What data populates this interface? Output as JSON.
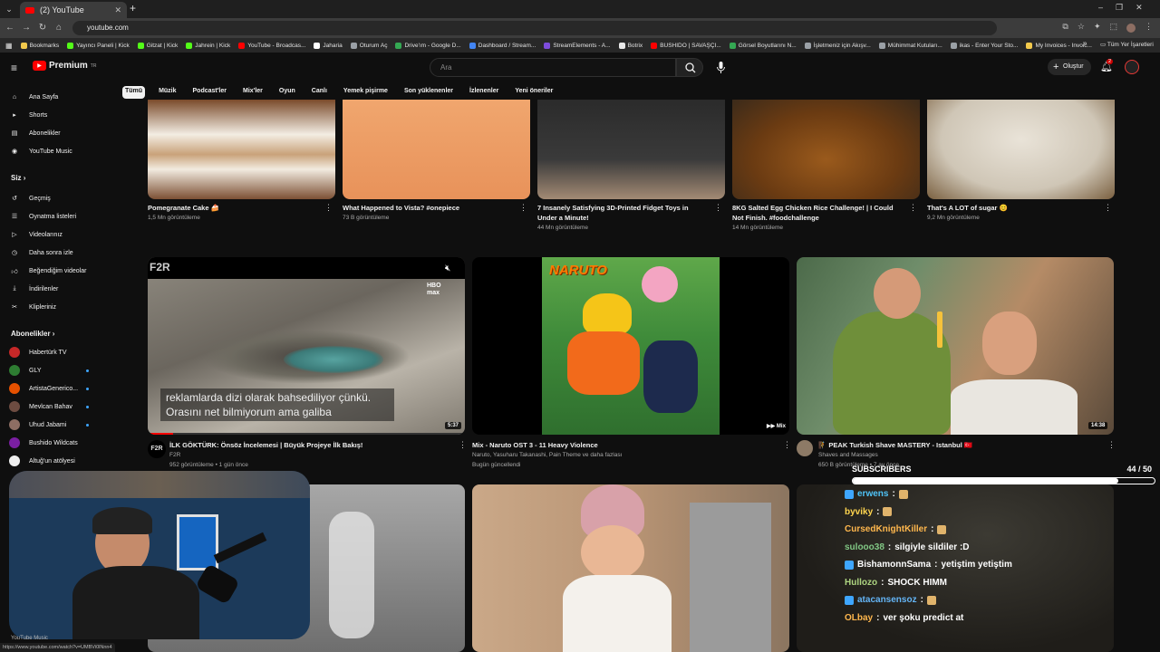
{
  "browser": {
    "tab_title": "(2) YouTube",
    "new_tab": "+",
    "url": "youtube.com",
    "bookmarks": [
      {
        "label": "Bookmarks",
        "color": "#f2c94c"
      },
      {
        "label": "Yayıncı Paneli | Kick",
        "color": "#53fc18"
      },
      {
        "label": "Gitzat | Kick",
        "color": "#53fc18"
      },
      {
        "label": "Jahrein | Kick",
        "color": "#53fc18"
      },
      {
        "label": "YouTube - Broadcas...",
        "color": "#ff0000"
      },
      {
        "label": "Jaharia",
        "color": "#ffffff"
      },
      {
        "label": "Oturum Aç",
        "color": "#9aa0a6"
      },
      {
        "label": "Drive'ım - Google D...",
        "color": "#34a853"
      },
      {
        "label": "Dashboard / Stream...",
        "color": "#4285f4"
      },
      {
        "label": "StreamElements - A...",
        "color": "#7d4cdb"
      },
      {
        "label": "Botrix",
        "color": "#e8e8e8"
      },
      {
        "label": "BUSHIDO | SAVAŞÇI...",
        "color": "#ff0000"
      },
      {
        "label": "Görsel Boyutlarını N...",
        "color": "#34a853"
      },
      {
        "label": "İşletmeniz için Akışv...",
        "color": "#9aa0a6"
      },
      {
        "label": "Mühimmat Kutuları...",
        "color": "#9aa0a6"
      },
      {
        "label": "ikas - Enter Your Sto...",
        "color": "#9aa0a6"
      },
      {
        "label": "My Invoices - Invoic...",
        "color": "#f2c94c"
      }
    ],
    "all_bookmarks": "Tüm Yer İşaretleri",
    "status_url": "https://www.youtube.com/watch?v=UMBVi0lNnn4"
  },
  "youtube": {
    "logo_text": "Premium",
    "logo_sup": "TR",
    "search_placeholder": "Ara",
    "create_label": "Oluştur",
    "notification_count": "2",
    "chips": [
      "Tümü",
      "Müzik",
      "Podcast'ler",
      "Mix'ler",
      "Oyun",
      "Canlı",
      "Yemek pişirme",
      "Son yüklenenler",
      "İzlenenler",
      "Yeni öneriler"
    ]
  },
  "sidebar": {
    "main": [
      {
        "label": "Ana Sayfa",
        "icon": "home-icon"
      },
      {
        "label": "Shorts",
        "icon": "shorts-icon"
      },
      {
        "label": "Abonelikler",
        "icon": "subscriptions-icon"
      },
      {
        "label": "YouTube Music",
        "icon": "music-icon"
      }
    ],
    "you_header": "Siz",
    "you": [
      {
        "label": "Geçmiş",
        "icon": "history-icon"
      },
      {
        "label": "Oynatma listeleri",
        "icon": "playlist-icon"
      },
      {
        "label": "Videolarınız",
        "icon": "your-videos-icon"
      },
      {
        "label": "Daha sonra izle",
        "icon": "watch-later-icon"
      },
      {
        "label": "Beğendiğim videolar",
        "icon": "like-icon"
      },
      {
        "label": "İndirilenler",
        "icon": "download-icon"
      },
      {
        "label": "Klipleriniz",
        "icon": "clips-icon"
      }
    ],
    "subs_header": "Abonelikler",
    "subs": [
      {
        "label": "Habertürk TV",
        "color": "#c62828",
        "live": false
      },
      {
        "label": "GLY",
        "color": "#2e7d32",
        "live": true
      },
      {
        "label": "ArtistaGenerico...",
        "color": "#e65100",
        "live": true
      },
      {
        "label": "Mevlcan Bahav",
        "color": "#6d4c41",
        "live": true
      },
      {
        "label": "Uhud Jabami",
        "color": "#8d6e63",
        "live": true
      },
      {
        "label": "Bushido Wildcats",
        "color": "#7b1fa2",
        "live": false
      },
      {
        "label": "Altuğ'un atölyesi",
        "color": "#eeeeee",
        "live": false
      }
    ],
    "bottom_label": "YouTube Music"
  },
  "videos_row1": [
    {
      "title": "Pomegranate Cake 🍰",
      "meta": "1,5 Mn görüntüleme"
    },
    {
      "title": "What Happened to Vista? #onepiece",
      "meta": "73 B görüntüleme"
    },
    {
      "title": "7 Insanely Satisfying 3D-Printed Fidget Toys in Under a Minute!",
      "meta": "44 Mn görüntüleme"
    },
    {
      "title": "8KG Salted Egg Chicken Rice Challenge! | I Could Not Finish. #foodchallenge",
      "meta": "14 Mn görüntüleme"
    },
    {
      "title": "That's A LOT of sugar 😊",
      "meta": "9,2 Mn görüntüleme"
    }
  ],
  "videos_row2": [
    {
      "title": "İLK GÖKTÜRK: Önsöz İncelemesi | Büyük Projeye İlk Bakış!",
      "channel": "F2R",
      "meta": "952 görüntüleme • 1 gün önce",
      "duration": "5:37",
      "overlay_brand": "F2R",
      "caption": "reklamlarda dizi olarak bahsediliyor çünkü. Orasını net bilmiyorum ama galiba",
      "hbo": "HBO max"
    },
    {
      "title": "Mix - Naruto OST 3 - 11 Heavy Violence",
      "channel": "Naruto, Yasuharu Takanashi, Pain Theme ve daha fazlası",
      "meta": "Bugün güncellendi",
      "duration": "Mix",
      "cover_title": "NARUTO"
    },
    {
      "title": "🧗 PEAK Turkish Shave MASTERY - Istanbul 🇹🇷",
      "channel": "Shaves and Massages",
      "meta": "650 B görüntüleme • 7 ay önce",
      "duration": "14:38"
    }
  ],
  "overlay": {
    "subscribers_label": "SUBSCRIBERS",
    "subscribers_count": "44 / 50",
    "subscribers_progress": 0.88,
    "chat": [
      {
        "user": "erwens",
        "text": "",
        "color": "#4fc3f7",
        "emote": true
      },
      {
        "user": "byviky",
        "text": "",
        "color": "#ffd54f",
        "emote": true
      },
      {
        "user": "CursedKnightKiller",
        "text": "",
        "color": "#ffb74d",
        "emote": true
      },
      {
        "user": "sulooo38",
        "text": "silgiyle sildiler :D",
        "color": "#81c784",
        "emote": false
      },
      {
        "user": "BishamonnSama",
        "text": "yetiştim yetiştim",
        "color": "#ffffff",
        "emote": false
      },
      {
        "user": "Hullozo",
        "text": "SHOCK HIMM",
        "color": "#aed581",
        "emote": false
      },
      {
        "user": "atacansensoz",
        "text": "",
        "color": "#64b5f6",
        "emote": true
      },
      {
        "user": "OLbay",
        "text": "ver şoku predict at",
        "color": "#ffb74d",
        "emote": false
      }
    ]
  }
}
